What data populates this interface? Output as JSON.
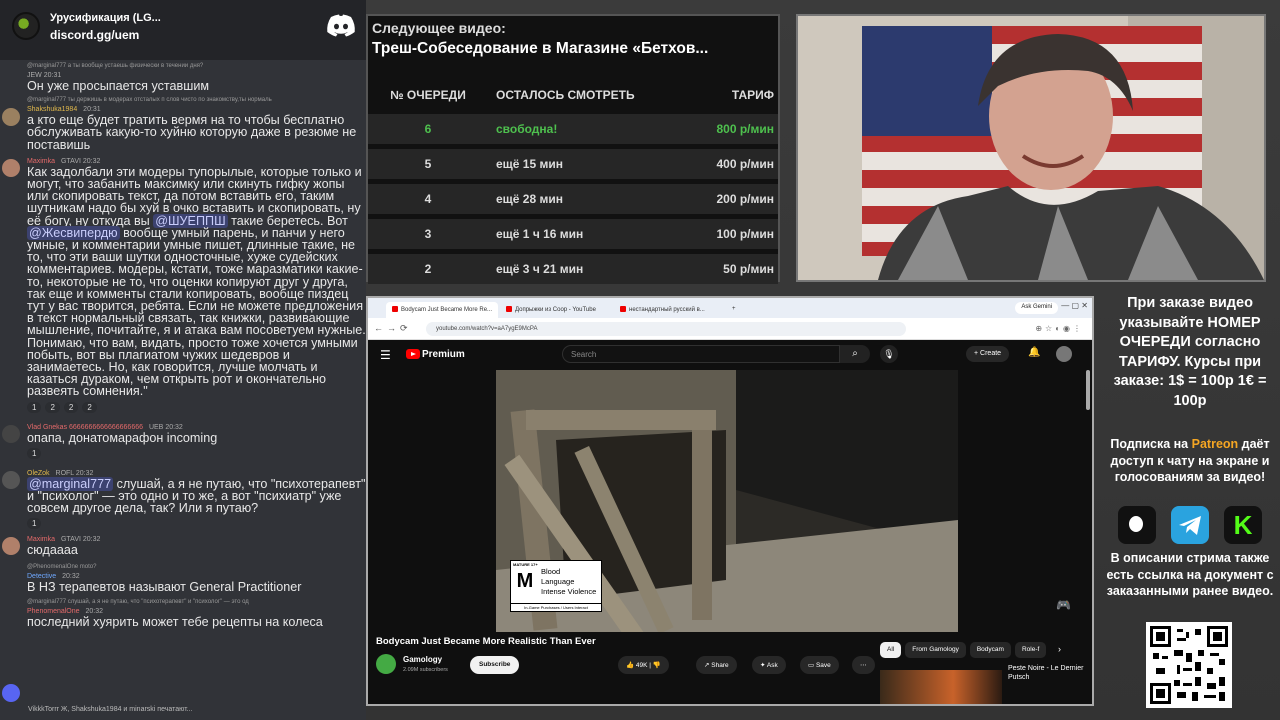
{
  "discord": {
    "server_name": "Урусификация (LG...",
    "invite": "discord.gg/uem",
    "messages": [
      {
        "meta_name": "",
        "meta_tags": "JEW",
        "time": "20:31",
        "reply": "@marginal777 а ты вообще устаешь физически в течении дня?",
        "text": "Он уже просыпается уставшим"
      },
      {
        "meta_name": "Shakshuka1984",
        "meta_tags": "",
        "time": "20:31",
        "reply": "@marginal777 ты держишь в модерах отсталых п слов чисто по знакомству,ты нормаль",
        "text": "а кто еще будет тратить вермя на то чтобы бесплатно обслуживать какую-то хуйню которую даже в резюме не поставишь"
      },
      {
        "meta_name": "Maximka",
        "meta_tags": "GTAVI",
        "time": "20:32",
        "reply": "",
        "text": "Как задолбали эти модеры тупорылые, которые только и могут, что забанить максимку или скинуть гифку жопы или скопировать текст, да потом вставить его, таким шутникам надо бы хуй в очко вставить и скопировать, ну её богу, ну откуда вы",
        "mention1": "@ШУЕППШ",
        "text2": "такие беретесь. Вот",
        "mention2": "@Жесвипердю",
        "text3": "вообще умный парень, и панчи у него умные, и комментарии умные пишет, длинные такие, не то, что эти ваши шутки односточные, хуже судейских комментариев. модеры, кстати, тоже маразматики какие-то, некоторые не то, что оценки копируют друг у друга, так еще и комменты стали копировать, вообще пиздец тут у вас творится, ребята. Если не можете предложения в текст нормальный связать, так книжки, развивающие мышление, почитайте, я и атака вам посоветуем нужные. Понимаю, что вам, видать, просто тоже хочется умными побыть, вот вы плагиатом чужих шедевров и занимаетесь. Но, как говорится, лучше молчать и казаться дураком, чем открыть рот и окончательно развеять сомнения.\"",
        "reactions": [
          "1",
          "2",
          "2",
          "2"
        ]
      },
      {
        "meta_name": "Vlad Gnekas 6666666666666666666",
        "meta_tags": "UEB",
        "time": "20:32",
        "reply": "",
        "text": "опапа, донатомарафон incoming",
        "reactions": [
          "1"
        ]
      },
      {
        "meta_name": "OleZok",
        "meta_tags": "ROFL",
        "time": "20:32",
        "reply": "",
        "mention1": "@marginal777",
        "text": "слушай, а я не путаю, что \"психотерапевт\" и \"психолог\" — это одно и то же, а вот \"психиатр\" уже совсем другое дела, так? Или я путаю?",
        "reactions": [
          "1"
        ]
      },
      {
        "meta_name": "Maximka",
        "meta_tags": "GTAVI",
        "time": "20:32",
        "reply": "",
        "text": "сюдаааа"
      },
      {
        "meta_name": "Detective",
        "meta_tags": "",
        "time": "20:32",
        "reply": "@PhenomenalOne moto?",
        "text": "В НЗ терапевтов называют General Practitioner"
      },
      {
        "meta_name": "PhenomenalOne",
        "meta_tags": "",
        "time": "20:32",
        "reply": "@marginal777 слушай, а я не путаю, что \"психотерапевт\" и \"психолог\" — это од",
        "text": "последний хуярить может тебе рецепты на колеса"
      }
    ],
    "typing": "VikkkTorrr Ж, Shakshuka1984 и minarski печатают..."
  },
  "queue": {
    "next_label": "Следующее видео:",
    "next_title": "Треш-Собеседование в Магазине «Бетхов...",
    "headers": {
      "num": "№ ОЧЕРЕДИ",
      "left": "ОСТАЛОСЬ СМОТРЕТЬ",
      "rate": "ТАРИФ"
    },
    "rows": [
      {
        "num": "6",
        "left": "свободна!",
        "rate": "800 р/мин",
        "free": true
      },
      {
        "num": "5",
        "left": "ещё 15 мин",
        "rate": "400 р/мин"
      },
      {
        "num": "4",
        "left": "ещё 28 мин",
        "rate": "200 р/мин"
      },
      {
        "num": "3",
        "left": "ещё 1 ч 16 мин",
        "rate": "100 р/мин"
      },
      {
        "num": "2",
        "left": "ещё 3 ч 21 мин",
        "rate": "50 р/мин"
      }
    ]
  },
  "browser": {
    "tabs": [
      "Bodycam Just Became More Re...",
      "Допрыжки из Coop - YouTube",
      "нестандартный русский в..."
    ],
    "gemini": "Ask Gemini",
    "url": "youtube.com/watch?v=aA7ygE9McPA",
    "brand": "Premium",
    "search_placeholder": "Search",
    "create": "Create",
    "rating": {
      "mature": "MATURE 17+",
      "letter": "M",
      "descriptors": [
        "Blood",
        "Language",
        "Intense Violence"
      ],
      "footer": "In-Game Purchases / Users Interact"
    },
    "video_title": "Bodycam Just Became More Realistic Than Ever",
    "channel": "Gamology",
    "subs": "2.09M subscribers",
    "subscribe": "Subscribe",
    "actions": {
      "likes": "49K",
      "share": "Share",
      "ask": "Ask",
      "save": "Save"
    },
    "chips": [
      "All",
      "From Gamology",
      "Bodycam",
      "Role-f"
    ],
    "rec_title": "Peste Noire - Le Dernier Putsch"
  },
  "info": {
    "order": "При заказе видео указывайте НОМЕР ОЧЕРЕДИ согласно ТАРИФУ. Курсы при заказе: 1$ = 100р 1€ = 100р",
    "patreon_pre": "Подписка на",
    "patreon_word": "Patreon",
    "patreon_post": "даёт доступ к чату на экране и голосованиям за видео!",
    "desc": "В описании стрима также есть ссылка на документ с заказанными ранее видео."
  },
  "colors": {
    "free": "#4ec04e",
    "accent_patreon": "#f5a623",
    "youtube_red": "#ff0000",
    "discord": "#5865f2"
  }
}
